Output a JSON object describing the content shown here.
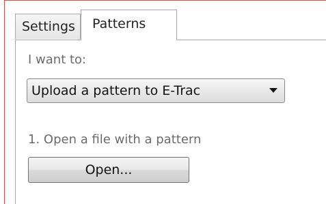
{
  "tabs": [
    {
      "label": "Settings",
      "active": false
    },
    {
      "label": "Patterns",
      "active": true
    }
  ],
  "patterns": {
    "want_label": "I want to:",
    "action_select": {
      "selected": "Upload a pattern to E-Trac"
    },
    "step1_label": "1. Open a file with a pattern",
    "open_button_label": "Open..."
  },
  "colors": {
    "outer_border": "#e24b4b",
    "panel_border": "#a8a8a8",
    "muted_text": "#6b6b6b"
  }
}
